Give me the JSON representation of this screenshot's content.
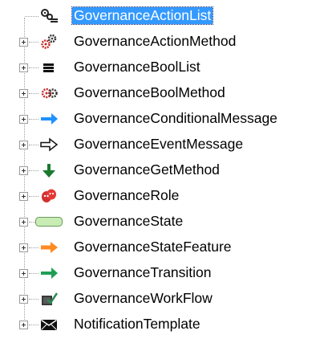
{
  "tree": {
    "items": [
      {
        "label": "GovernanceActionList",
        "icon": "list-gears-icon",
        "selected": true,
        "expander": false
      },
      {
        "label": "GovernanceActionMethod",
        "icon": "gears-red-icon",
        "selected": false,
        "expander": true
      },
      {
        "label": "GovernanceBoolList",
        "icon": "bool-list-icon",
        "selected": false,
        "expander": true
      },
      {
        "label": "GovernanceBoolMethod",
        "icon": "bool-gear-icon",
        "selected": false,
        "expander": true
      },
      {
        "label": "GovernanceConditionalMessage",
        "icon": "blue-arrow-icon",
        "selected": false,
        "expander": true
      },
      {
        "label": "GovernanceEventMessage",
        "icon": "hollow-arrow-icon",
        "selected": false,
        "expander": true
      },
      {
        "label": "GovernanceGetMethod",
        "icon": "green-down-arrow-icon",
        "selected": false,
        "expander": true
      },
      {
        "label": "GovernanceRole",
        "icon": "theater-masks-icon",
        "selected": false,
        "expander": true
      },
      {
        "label": "GovernanceState",
        "icon": "state-rounded-rect-icon",
        "selected": false,
        "expander": true
      },
      {
        "label": "GovernanceStateFeature",
        "icon": "orange-arrow-icon",
        "selected": false,
        "expander": true
      },
      {
        "label": "GovernanceTransition",
        "icon": "green-arrow-icon",
        "selected": false,
        "expander": true
      },
      {
        "label": "GovernanceWorkFlow",
        "icon": "workflow-clipboard-icon",
        "selected": false,
        "expander": true
      },
      {
        "label": "NotificationTemplate",
        "icon": "envelope-icon",
        "selected": false,
        "expander": true
      }
    ]
  },
  "colors": {
    "selection": "#3399ff",
    "selection_text": "#ffffff",
    "tree_line": "#a0a0a0",
    "blue_arrow": "#1e90ff",
    "green_arrow": "#1f9e55",
    "orange_arrow": "#ff8a1f",
    "state_fill": "#c8ecb4"
  }
}
